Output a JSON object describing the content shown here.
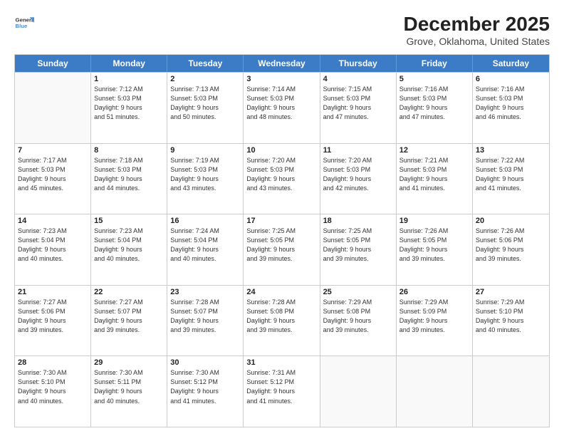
{
  "header": {
    "logo": {
      "line1": "General",
      "line2": "Blue"
    },
    "title": "December 2025",
    "subtitle": "Grove, Oklahoma, United States"
  },
  "days_of_week": [
    "Sunday",
    "Monday",
    "Tuesday",
    "Wednesday",
    "Thursday",
    "Friday",
    "Saturday"
  ],
  "weeks": [
    [
      {
        "day": "",
        "sunrise": "",
        "sunset": "",
        "daylight": "",
        "empty": true
      },
      {
        "day": "1",
        "sunrise": "7:12 AM",
        "sunset": "5:03 PM",
        "daylight": "9 hours and 51 minutes."
      },
      {
        "day": "2",
        "sunrise": "7:13 AM",
        "sunset": "5:03 PM",
        "daylight": "9 hours and 50 minutes."
      },
      {
        "day": "3",
        "sunrise": "7:14 AM",
        "sunset": "5:03 PM",
        "daylight": "9 hours and 48 minutes."
      },
      {
        "day": "4",
        "sunrise": "7:15 AM",
        "sunset": "5:03 PM",
        "daylight": "9 hours and 47 minutes."
      },
      {
        "day": "5",
        "sunrise": "7:16 AM",
        "sunset": "5:03 PM",
        "daylight": "9 hours and 47 minutes."
      },
      {
        "day": "6",
        "sunrise": "7:16 AM",
        "sunset": "5:03 PM",
        "daylight": "9 hours and 46 minutes."
      }
    ],
    [
      {
        "day": "7",
        "sunrise": "7:17 AM",
        "sunset": "5:03 PM",
        "daylight": "9 hours and 45 minutes."
      },
      {
        "day": "8",
        "sunrise": "7:18 AM",
        "sunset": "5:03 PM",
        "daylight": "9 hours and 44 minutes."
      },
      {
        "day": "9",
        "sunrise": "7:19 AM",
        "sunset": "5:03 PM",
        "daylight": "9 hours and 43 minutes."
      },
      {
        "day": "10",
        "sunrise": "7:20 AM",
        "sunset": "5:03 PM",
        "daylight": "9 hours and 43 minutes."
      },
      {
        "day": "11",
        "sunrise": "7:20 AM",
        "sunset": "5:03 PM",
        "daylight": "9 hours and 42 minutes."
      },
      {
        "day": "12",
        "sunrise": "7:21 AM",
        "sunset": "5:03 PM",
        "daylight": "9 hours and 41 minutes."
      },
      {
        "day": "13",
        "sunrise": "7:22 AM",
        "sunset": "5:03 PM",
        "daylight": "9 hours and 41 minutes."
      }
    ],
    [
      {
        "day": "14",
        "sunrise": "7:23 AM",
        "sunset": "5:04 PM",
        "daylight": "9 hours and 40 minutes."
      },
      {
        "day": "15",
        "sunrise": "7:23 AM",
        "sunset": "5:04 PM",
        "daylight": "9 hours and 40 minutes."
      },
      {
        "day": "16",
        "sunrise": "7:24 AM",
        "sunset": "5:04 PM",
        "daylight": "9 hours and 40 minutes."
      },
      {
        "day": "17",
        "sunrise": "7:25 AM",
        "sunset": "5:05 PM",
        "daylight": "9 hours and 39 minutes."
      },
      {
        "day": "18",
        "sunrise": "7:25 AM",
        "sunset": "5:05 PM",
        "daylight": "9 hours and 39 minutes."
      },
      {
        "day": "19",
        "sunrise": "7:26 AM",
        "sunset": "5:05 PM",
        "daylight": "9 hours and 39 minutes."
      },
      {
        "day": "20",
        "sunrise": "7:26 AM",
        "sunset": "5:06 PM",
        "daylight": "9 hours and 39 minutes."
      }
    ],
    [
      {
        "day": "21",
        "sunrise": "7:27 AM",
        "sunset": "5:06 PM",
        "daylight": "9 hours and 39 minutes."
      },
      {
        "day": "22",
        "sunrise": "7:27 AM",
        "sunset": "5:07 PM",
        "daylight": "9 hours and 39 minutes."
      },
      {
        "day": "23",
        "sunrise": "7:28 AM",
        "sunset": "5:07 PM",
        "daylight": "9 hours and 39 minutes."
      },
      {
        "day": "24",
        "sunrise": "7:28 AM",
        "sunset": "5:08 PM",
        "daylight": "9 hours and 39 minutes."
      },
      {
        "day": "25",
        "sunrise": "7:29 AM",
        "sunset": "5:08 PM",
        "daylight": "9 hours and 39 minutes."
      },
      {
        "day": "26",
        "sunrise": "7:29 AM",
        "sunset": "5:09 PM",
        "daylight": "9 hours and 39 minutes."
      },
      {
        "day": "27",
        "sunrise": "7:29 AM",
        "sunset": "5:10 PM",
        "daylight": "9 hours and 40 minutes."
      }
    ],
    [
      {
        "day": "28",
        "sunrise": "7:30 AM",
        "sunset": "5:10 PM",
        "daylight": "9 hours and 40 minutes."
      },
      {
        "day": "29",
        "sunrise": "7:30 AM",
        "sunset": "5:11 PM",
        "daylight": "9 hours and 40 minutes."
      },
      {
        "day": "30",
        "sunrise": "7:30 AM",
        "sunset": "5:12 PM",
        "daylight": "9 hours and 41 minutes."
      },
      {
        "day": "31",
        "sunrise": "7:31 AM",
        "sunset": "5:12 PM",
        "daylight": "9 hours and 41 minutes."
      },
      {
        "day": "",
        "sunrise": "",
        "sunset": "",
        "daylight": "",
        "empty": true
      },
      {
        "day": "",
        "sunrise": "",
        "sunset": "",
        "daylight": "",
        "empty": true
      },
      {
        "day": "",
        "sunrise": "",
        "sunset": "",
        "daylight": "",
        "empty": true
      }
    ]
  ],
  "labels": {
    "sunrise_prefix": "Sunrise: ",
    "sunset_prefix": "Sunset: ",
    "daylight_prefix": "Daylight: "
  }
}
